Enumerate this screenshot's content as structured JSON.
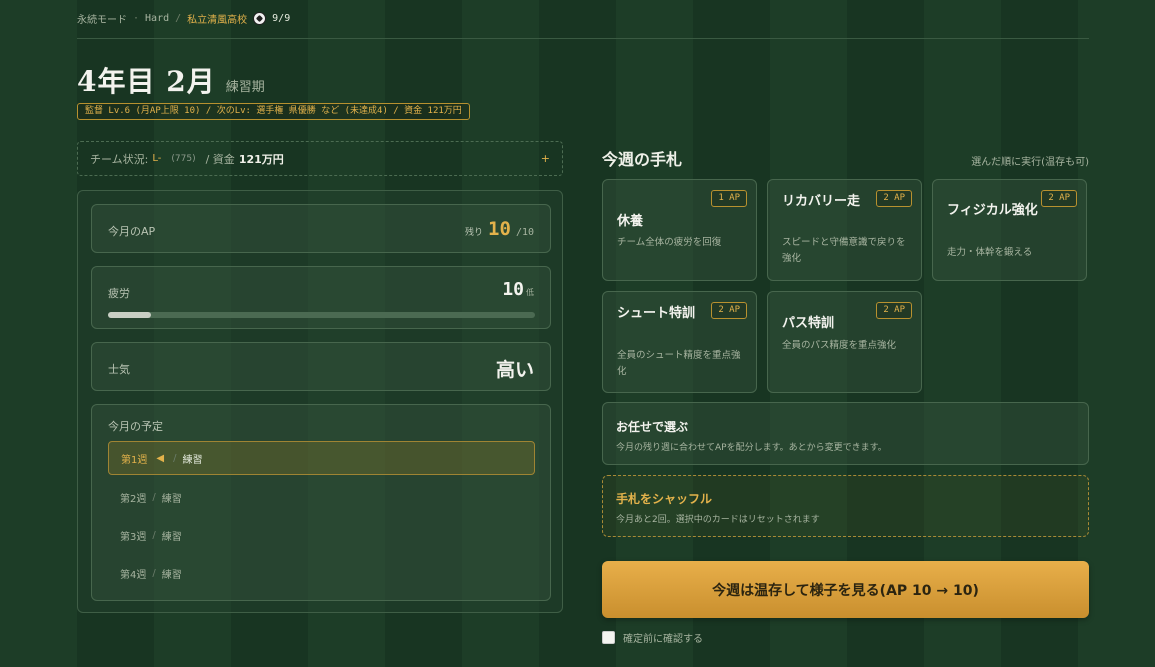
{
  "breadcrumb": {
    "mode": "永続モード",
    "dot": "·",
    "difficulty": "Hard",
    "slash": "/",
    "school": "私立清風高校",
    "count": "9/9"
  },
  "header": {
    "title": "4年目 2月",
    "phase": "練習期",
    "pill": "監督 Lv.6 (月AP上限 10)  / 次のLv: 選手権 県優勝 など (未達成4)  / 資金 121万円"
  },
  "team": {
    "label": "チーム状況:",
    "level": "L-",
    "rating": "(775)",
    "money_label": "/ 資金",
    "money_value": "121万円",
    "expand": "+"
  },
  "status": {
    "ap_label": "今月のAP",
    "ap_remaining_label": "残り",
    "ap_remaining": "10",
    "ap_total": "/10",
    "fatigue_label": "疲労",
    "fatigue_value": "10",
    "fatigue_unit": "低",
    "fatigue_level": 0.1,
    "morale_label": "士気",
    "morale_value": "高い"
  },
  "schedule": {
    "label": "今月の予定",
    "weeks": [
      {
        "week": "第1週",
        "activity": "練習",
        "active": true
      },
      {
        "week": "第2週",
        "activity": "練習",
        "active": false
      },
      {
        "week": "第3週",
        "activity": "練習",
        "active": false
      },
      {
        "week": "第4週",
        "activity": "練習",
        "active": false
      }
    ]
  },
  "hand": {
    "title": "今週の手札",
    "note": "選んだ順に実行(温存も可)",
    "cards": [
      {
        "name": "休養",
        "cost": "1 AP",
        "desc": "チーム全体の疲労を回復"
      },
      {
        "name": "リカバリー走",
        "cost": "2 AP",
        "desc": "スピードと守備意識で戻りを強化"
      },
      {
        "name": "フィジカル強化",
        "cost": "2 AP",
        "desc": "走力・体幹を鍛える"
      },
      {
        "name": "シュート特訓",
        "cost": "2 AP",
        "desc": "全員のシュート精度を重点強化"
      },
      {
        "name": "パス特訓",
        "cost": "2 AP",
        "desc": "全員のパス精度を重点強化"
      }
    ],
    "omakase_title": "お任せで選ぶ",
    "omakase_desc": "今月の残り週に合わせてAPを配分します。あとから変更できます。",
    "shuffle_title": "手札をシャッフル",
    "shuffle_desc": "今月あと2回。選択中のカードはリセットされます"
  },
  "actions": {
    "cta": "今週は温存して様子を見る(AP 10 → 10)",
    "confirm": "確定前に確認する"
  }
}
